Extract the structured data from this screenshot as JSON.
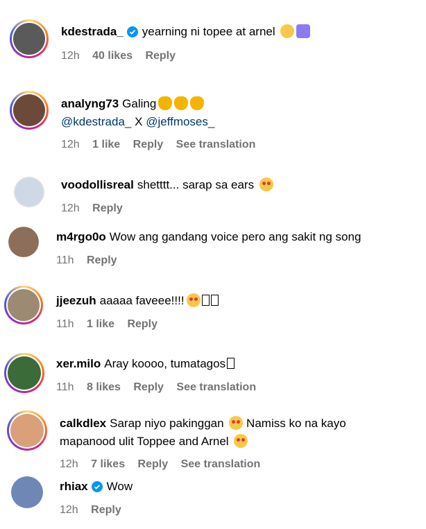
{
  "comments": [
    {
      "username": "kdestrada_",
      "verified": true,
      "text": "yearning ni topee at arnel",
      "time": "12h",
      "likes": "40 likes",
      "reply": "Reply",
      "avatar_color": "#5a5a5a"
    },
    {
      "username": "analyng73",
      "text": "Galing",
      "mention1": "@kdestrada_",
      "sep": "X",
      "mention2": "@jeffmoses_",
      "time": "12h",
      "likes": "1 like",
      "reply": "Reply",
      "translation": "See translation",
      "avatar_color": "#6b4a3a"
    },
    {
      "username": "voodollisreal",
      "text": "shetttt... sarap sa ears",
      "time": "12h",
      "reply": "Reply",
      "avatar_color": "#cfd9e6"
    },
    {
      "username": "m4rgo0o",
      "text": "Wow ang gandang voice pero ang sakit ng song",
      "time": "11h",
      "reply": "Reply",
      "avatar_color": "#8c6e5a"
    },
    {
      "username": "jjeezuh",
      "text": "aaaaa faveee!!!!",
      "time": "11h",
      "likes": "1 like",
      "reply": "Reply",
      "avatar_color": "#9c8a73"
    },
    {
      "username": "xer.milo",
      "text": "Aray koooo, tumatagos",
      "time": "11h",
      "likes": "8 likes",
      "reply": "Reply",
      "translation": "See translation",
      "avatar_color": "#3c6b3a"
    },
    {
      "username": "calkdlex",
      "text": "Sarap niyo pakinggan",
      "text2": "Namiss ko na kayo",
      "text3": "mapanood ulit Toppee and Arnel",
      "time": "12h",
      "likes": "7 likes",
      "reply": "Reply",
      "translation": "See translation",
      "avatar_color": "#d9a07a"
    },
    {
      "username": "rhiax",
      "verified": true,
      "text": "Wow",
      "time": "12h",
      "reply": "Reply",
      "avatar_color": "#6f87b5"
    }
  ],
  "colors": {
    "meta": "#737373",
    "mention": "#00376b",
    "verified": "#0095f6"
  }
}
